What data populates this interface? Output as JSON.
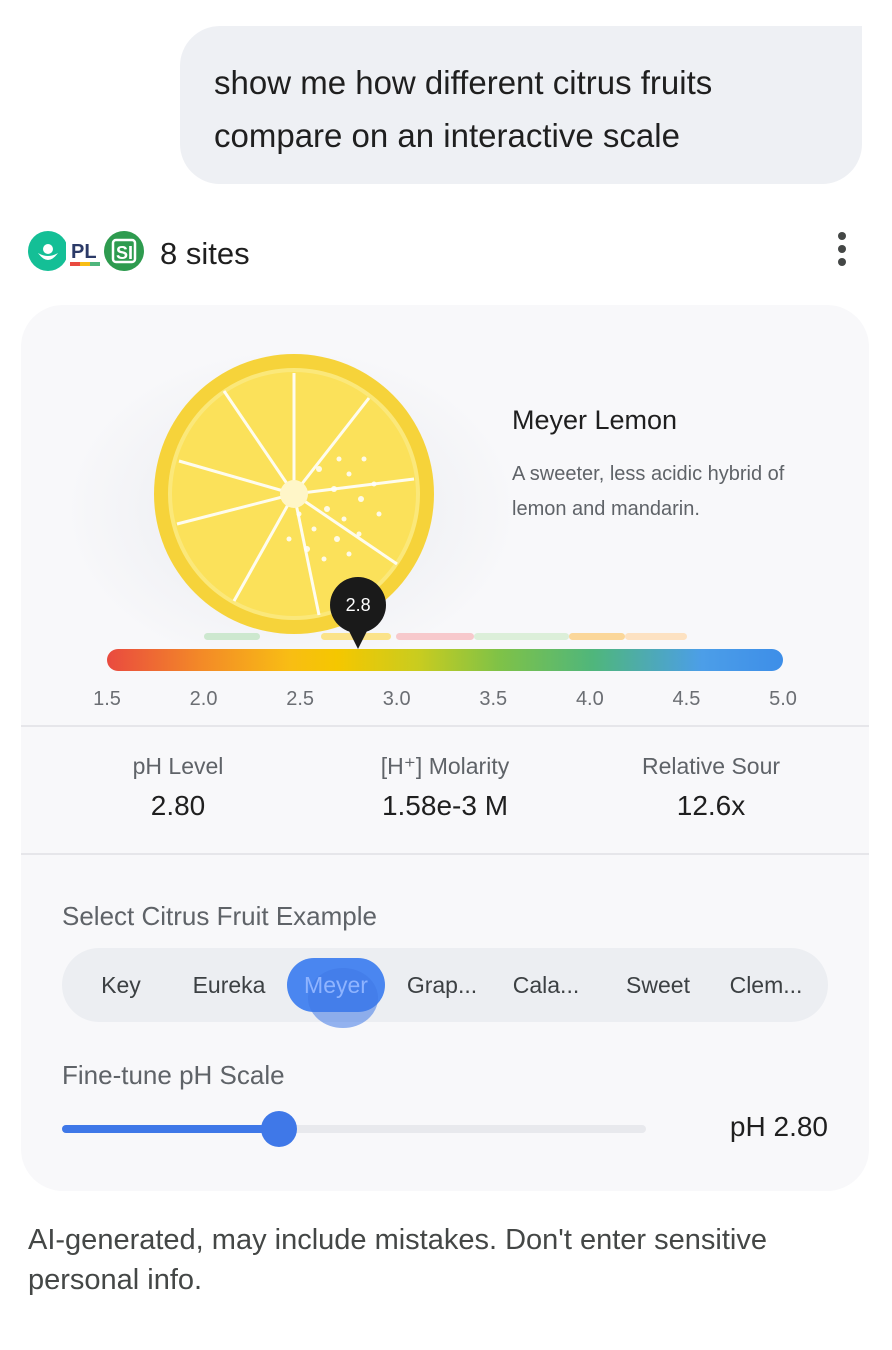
{
  "user_message": "show me how different citrus fruits compare on an interactive scale",
  "sources": {
    "label": "8 sites",
    "icons": [
      "khan-academy-icon",
      "pl-icon",
      "si-icon"
    ],
    "menu_icon": "more-vert-icon"
  },
  "fruit": {
    "name": "Meyer Lemon",
    "description": "A sweeter, less acidic hybrid of lemon and mandarin."
  },
  "scale": {
    "min": 1.5,
    "max": 5.0,
    "ticks": [
      "1.5",
      "2.0",
      "2.5",
      "3.0",
      "3.5",
      "4.0",
      "4.5",
      "5.0"
    ],
    "marker_value": 2.8,
    "marker_label": "2.8"
  },
  "stats": [
    {
      "label": "pH Level",
      "value": "2.80"
    },
    {
      "label": "[H⁺] Molarity",
      "value": "1.58e-3 M"
    },
    {
      "label": "Relative Sour",
      "value": "12.6x"
    }
  ],
  "selector": {
    "label": "Select Citrus Fruit Example",
    "options": [
      "Key",
      "Eureka",
      "Meyer",
      "Grap...",
      "Cala...",
      "Sweet",
      "Clem..."
    ],
    "selected": "Meyer"
  },
  "fine_tune": {
    "label": "Fine-tune pH Scale",
    "value": 2.8,
    "value_label": "pH 2.80"
  },
  "disclaimer": "AI-generated, may include mistakes. Don't enter sensitive personal info.",
  "colors": {
    "accent": "#3f78e8",
    "lemon": "#fbe15a",
    "rind": "#f6d33a",
    "card": "#f8f8fa"
  }
}
